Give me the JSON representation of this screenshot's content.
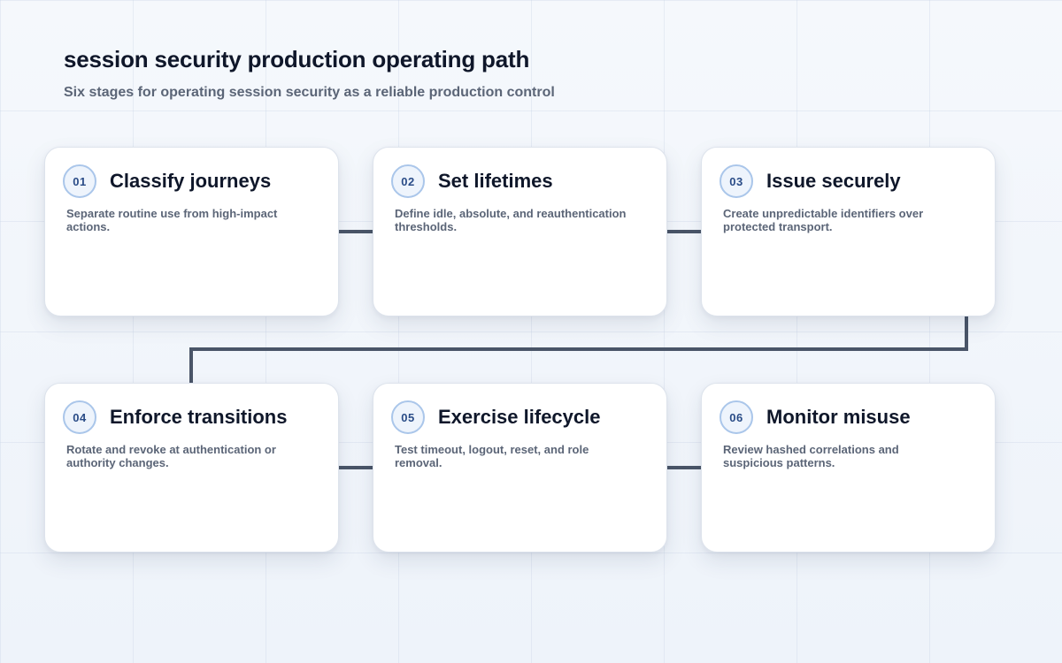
{
  "header": {
    "title": "session security production operating path",
    "subtitle": "Six stages for operating session security as a reliable production control"
  },
  "stages": [
    {
      "number": "01",
      "title": "Classify journeys",
      "description": "Separate routine use from high-impact actions."
    },
    {
      "number": "02",
      "title": "Set lifetimes",
      "description": "Define idle, absolute, and reauthentication thresholds."
    },
    {
      "number": "03",
      "title": "Issue securely",
      "description": "Create unpredictable identifiers over protected transport."
    },
    {
      "number": "04",
      "title": "Enforce transitions",
      "description": "Rotate and revoke at authentication or authority changes."
    },
    {
      "number": "05",
      "title": "Exercise lifecycle",
      "description": "Test timeout, logout, reset, and role removal."
    },
    {
      "number": "06",
      "title": "Monitor misuse",
      "description": "Review hashed correlations and suspicious patterns."
    }
  ],
  "colors": {
    "connector": "#4a5568",
    "badge_border": "#aac6ea",
    "badge_text": "#2a4c87"
  }
}
